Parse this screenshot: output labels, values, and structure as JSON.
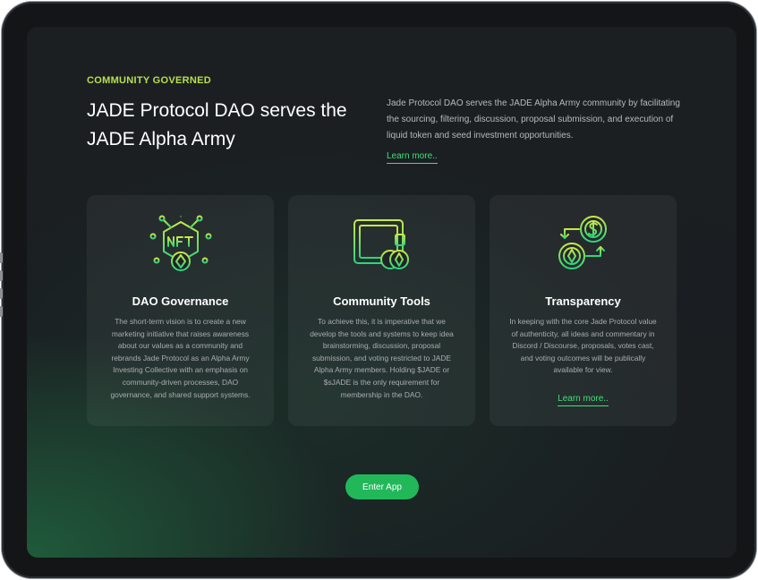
{
  "hero": {
    "eyebrow": "COMMUNITY GOVERNED",
    "headline": "JADE Protocol DAO serves the JADE Alpha Army",
    "intro": "Jade Protocol DAO serves the JADE Alpha Army community by facilitating the sourcing, filtering, discussion, proposal submission, and execution of liquid token and seed investment opportunities.",
    "learn_more": "Learn more.."
  },
  "cards": [
    {
      "icon": "nft-chip-icon",
      "title": "DAO Governance",
      "description": "The short-term vision is to create a new marketing initiative that raises awareness about our values as a community and rebrands Jade Protocol as an Alpha Army Investing Collective with an emphasis on community-driven processes, DAO governance, and shared support systems."
    },
    {
      "icon": "wallet-coins-icon",
      "title": "Community Tools",
      "description": "To achieve this, it is imperative that we develop the tools and systems to keep idea brainstorming, discussion, proposal submission, and voting restricted to JADE Alpha Army members. Holding $JADE or $sJADE is the only requirement for membership in the DAO."
    },
    {
      "icon": "exchange-coins-icon",
      "title": "Transparency",
      "description": "In keeping with the core Jade Protocol value of authenticity, all ideas and commentary in Discord / Discourse, proposals, votes cast, and voting outcomes will be publically available for view.",
      "learn_more": "Learn more.."
    }
  ],
  "cta": {
    "label": "Enter App"
  },
  "colors": {
    "accent_green": "#22b85a",
    "link_green": "#3ee07a",
    "eyebrow_lime": "#b8e04a",
    "background": "#1b1f22"
  }
}
